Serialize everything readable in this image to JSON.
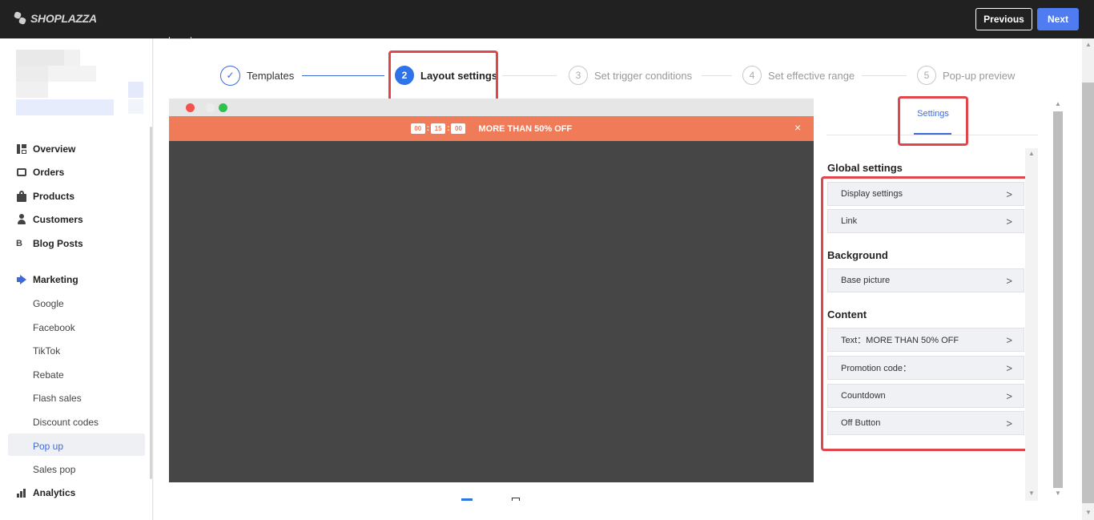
{
  "header": {
    "logo_text": "SHOPLAZZA",
    "previous_label": "Previous",
    "next_label": "Next"
  },
  "sidebar": {
    "items": [
      {
        "label": "Overview",
        "icon": "dashboard-icon"
      },
      {
        "label": "Orders",
        "icon": "inbox-icon"
      },
      {
        "label": "Products",
        "icon": "bag-icon"
      },
      {
        "label": "Customers",
        "icon": "person-icon"
      },
      {
        "label": "Blog Posts",
        "icon": "blog-icon"
      },
      {
        "label": "Marketing",
        "icon": "megaphone-icon"
      },
      {
        "label": "Analytics",
        "icon": "bar-chart-icon"
      }
    ],
    "marketing_sub": [
      "Google",
      "Facebook",
      "TikTok",
      "Rebate",
      "Flash sales",
      "Discount codes",
      "Pop up",
      "Sales pop"
    ],
    "active_sub": "Pop up"
  },
  "steps": [
    {
      "num": "✓",
      "label": "Templates",
      "state": "done"
    },
    {
      "num": "2",
      "label": "Layout settings",
      "state": "active"
    },
    {
      "num": "3",
      "label": "Set trigger conditions",
      "state": "pending"
    },
    {
      "num": "4",
      "label": "Set effective range",
      "state": "pending"
    },
    {
      "num": "5",
      "label": "Pop-up preview",
      "state": "pending"
    }
  ],
  "preview": {
    "countdown": [
      "00",
      "15",
      "00"
    ],
    "banner_text": "MORE THAN 50% OFF",
    "close": "×",
    "banner_color": "#ef7b58"
  },
  "settings_panel": {
    "tab": "Settings",
    "global_title": "Global settings",
    "global_rows": [
      "Display settings",
      "Link"
    ],
    "background_title": "Background",
    "background_rows": [
      "Base picture"
    ],
    "content_title": "Content",
    "content_rows": [
      "Text：MORE THAN 50% OFF",
      "Promotion code：",
      "Countdown",
      "Off Button"
    ]
  },
  "colors": {
    "accent": "#3e6ad8",
    "next_button": "#4f7cf0",
    "highlight": "#e0474c"
  }
}
